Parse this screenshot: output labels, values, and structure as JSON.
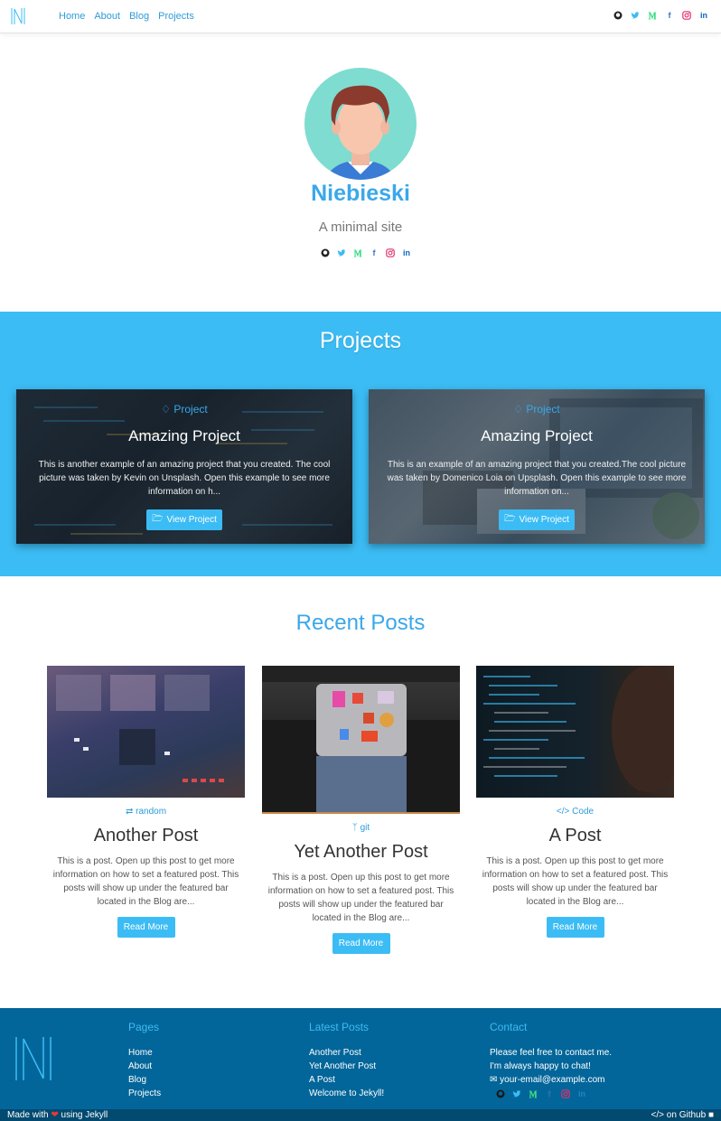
{
  "nav": {
    "links": [
      "Home",
      "About",
      "Blog",
      "Projects"
    ],
    "social_icons": [
      "github-icon",
      "twitter-icon",
      "medium-icon",
      "facebook-icon",
      "instagram-icon",
      "linkedin-icon"
    ]
  },
  "hero": {
    "name": "Niebieski",
    "tagline": "A minimal site"
  },
  "projects": {
    "title": "Projects",
    "items": [
      {
        "tag": "Project",
        "title": "Amazing Project",
        "description": "This is another example of an amazing project that you created. The cool picture was taken by Kevin on Unsplash. Open this example to see more information on h...",
        "button": "View Project"
      },
      {
        "tag": "Project",
        "title": "Amazing Project",
        "description": "This is an example of an amazing project that you created.The cool picture was taken by Domenico Loia on Upsplash. Open this example to see more information on...",
        "button": "View Project"
      }
    ]
  },
  "recent": {
    "title": "Recent Posts",
    "posts": [
      {
        "category": "random",
        "title": "Another Post",
        "description": "This is a post. Open up this post to get more information on how to set a featured post. This posts will show up under the featured bar located in the Blog are...",
        "button": "Read More"
      },
      {
        "category": "git",
        "title": "Yet Another Post",
        "description": "This is a post. Open up this post to get more information on how to set a featured post. This posts will show up under the featured bar located in the Blog are...",
        "button": "Read More"
      },
      {
        "category": "Code",
        "title": "A Post",
        "description": "This is a post. Open up this post to get more information on how to set a featured post. This posts will show up under the featured bar located in the Blog are...",
        "button": "Read More"
      }
    ]
  },
  "footer": {
    "pages": {
      "heading": "Pages",
      "links": [
        "Home",
        "About",
        "Blog",
        "Projects"
      ]
    },
    "latest": {
      "heading": "Latest Posts",
      "links": [
        "Another Post",
        "Yet Another Post",
        "A Post",
        "Welcome to Jekyll!"
      ]
    },
    "contact": {
      "heading": "Contact",
      "line1": "Please feel free to contact me.",
      "line2": "I'm always happy to chat!",
      "email": "your-email@example.com"
    },
    "made_with_prefix": "Made with",
    "made_with_suffix": "using Jekyll",
    "github_link": "on Github"
  },
  "colors": {
    "accent": "#3cbcf4",
    "link": "#2d9cdb",
    "footer_bg": "#03669a",
    "bottom_bar_bg": "#024a70"
  }
}
